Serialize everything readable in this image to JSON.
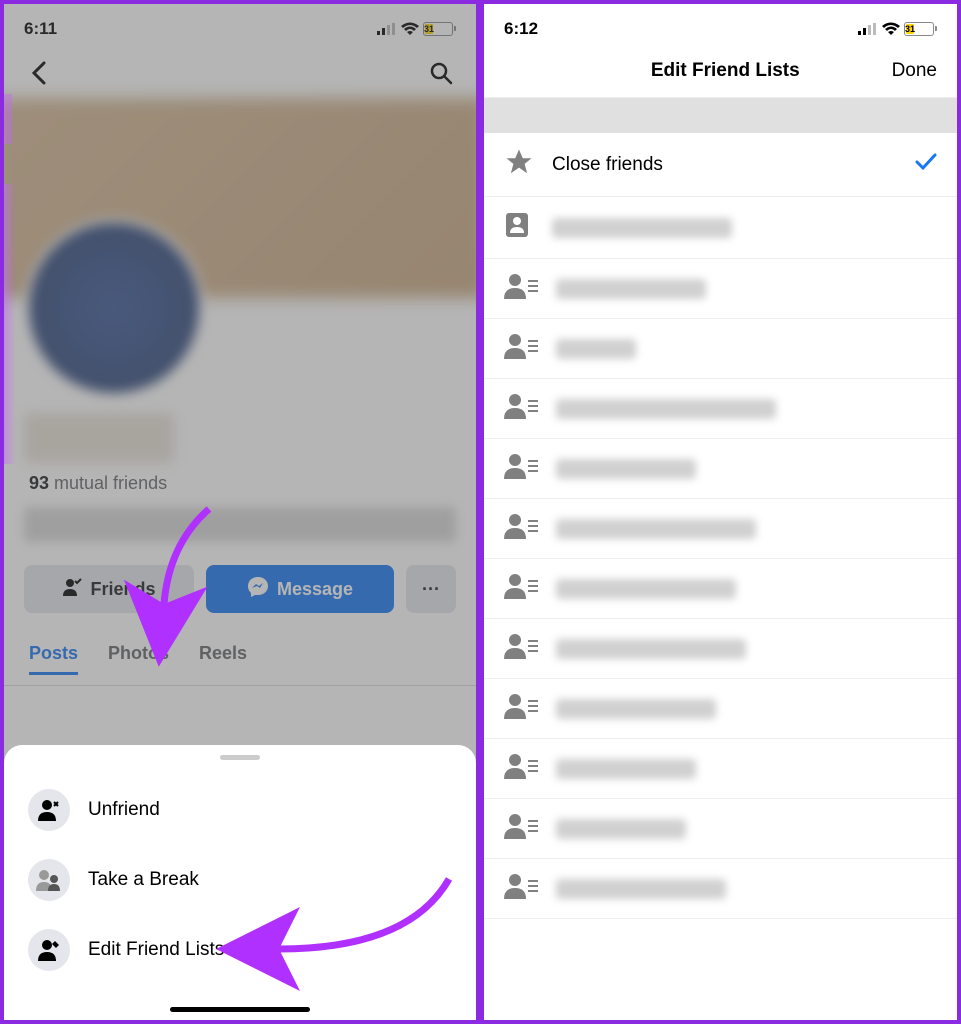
{
  "left": {
    "status": {
      "time": "6:11",
      "battery": "31"
    },
    "mutual_count": "93",
    "mutual_label": " mutual friends",
    "btn_friends": "Friends",
    "btn_message": "Message",
    "btn_more": "···",
    "tabs": {
      "posts": "Posts",
      "photos": "Photos",
      "reels": "Reels"
    },
    "sheet": {
      "unfriend": "Unfriend",
      "take_break": "Take a Break",
      "edit_lists": "Edit Friend Lists"
    }
  },
  "right": {
    "status": {
      "time": "6:12",
      "battery": "31"
    },
    "nav_title": "Edit Friend Lists",
    "nav_done": "Done",
    "close_friends": "Close friends",
    "blur_items": [
      180,
      150,
      80,
      220,
      140,
      200,
      180,
      190,
      160,
      140,
      130,
      170
    ]
  }
}
